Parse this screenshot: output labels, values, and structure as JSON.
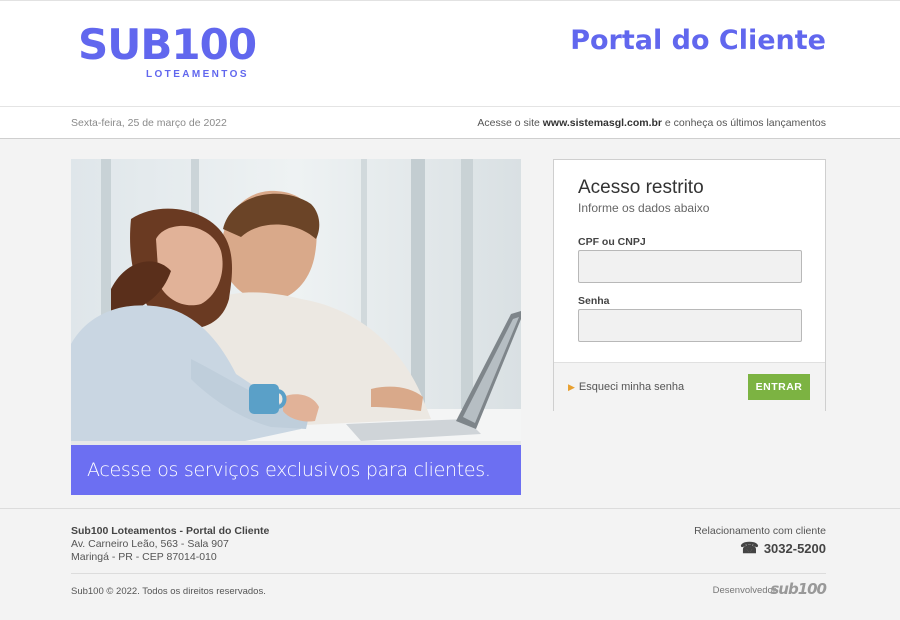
{
  "header": {
    "logo_main": "SUB100",
    "logo_sub": "LOTEAMENTOS",
    "portal_title": "Portal do Cliente"
  },
  "infobar": {
    "date": "Sexta-feira, 25 de março de 2022",
    "site_prefix": "Acesse o site ",
    "site_url": "www.sistemasgl.com.br",
    "site_suffix": " e conheça os últimos lançamentos"
  },
  "hero": {
    "banner_text": "Acesse os serviços exclusivos para clientes."
  },
  "login": {
    "title": "Acesso restrito",
    "subtitle": "Informe os dados abaixo",
    "cpf_label": "CPF ou CNPJ",
    "cpf_value": "",
    "password_label": "Senha",
    "password_value": "",
    "forgot_label": "Esqueci minha senha",
    "submit_label": "ENTRAR"
  },
  "footer": {
    "company": "Sub100 Loteamentos - Portal do Cliente",
    "address_line1": "Av. Carneiro Leão, 563 - Sala 907",
    "address_line2": "Maringá - PR - CEP 87014-010",
    "relationship_label": "Relacionamento com cliente",
    "phone": "3032-5200",
    "copyright": "Sub100 © 2022. Todos os direitos reservados.",
    "developer_label": "Desenvolvedor",
    "developer_logo": "sub100"
  },
  "colors": {
    "brand": "#6167ee",
    "banner": "#6c6ff2",
    "button": "#7cb342"
  },
  "icons": {
    "phone": "phone-icon",
    "arrow": "arrow-right-icon"
  }
}
